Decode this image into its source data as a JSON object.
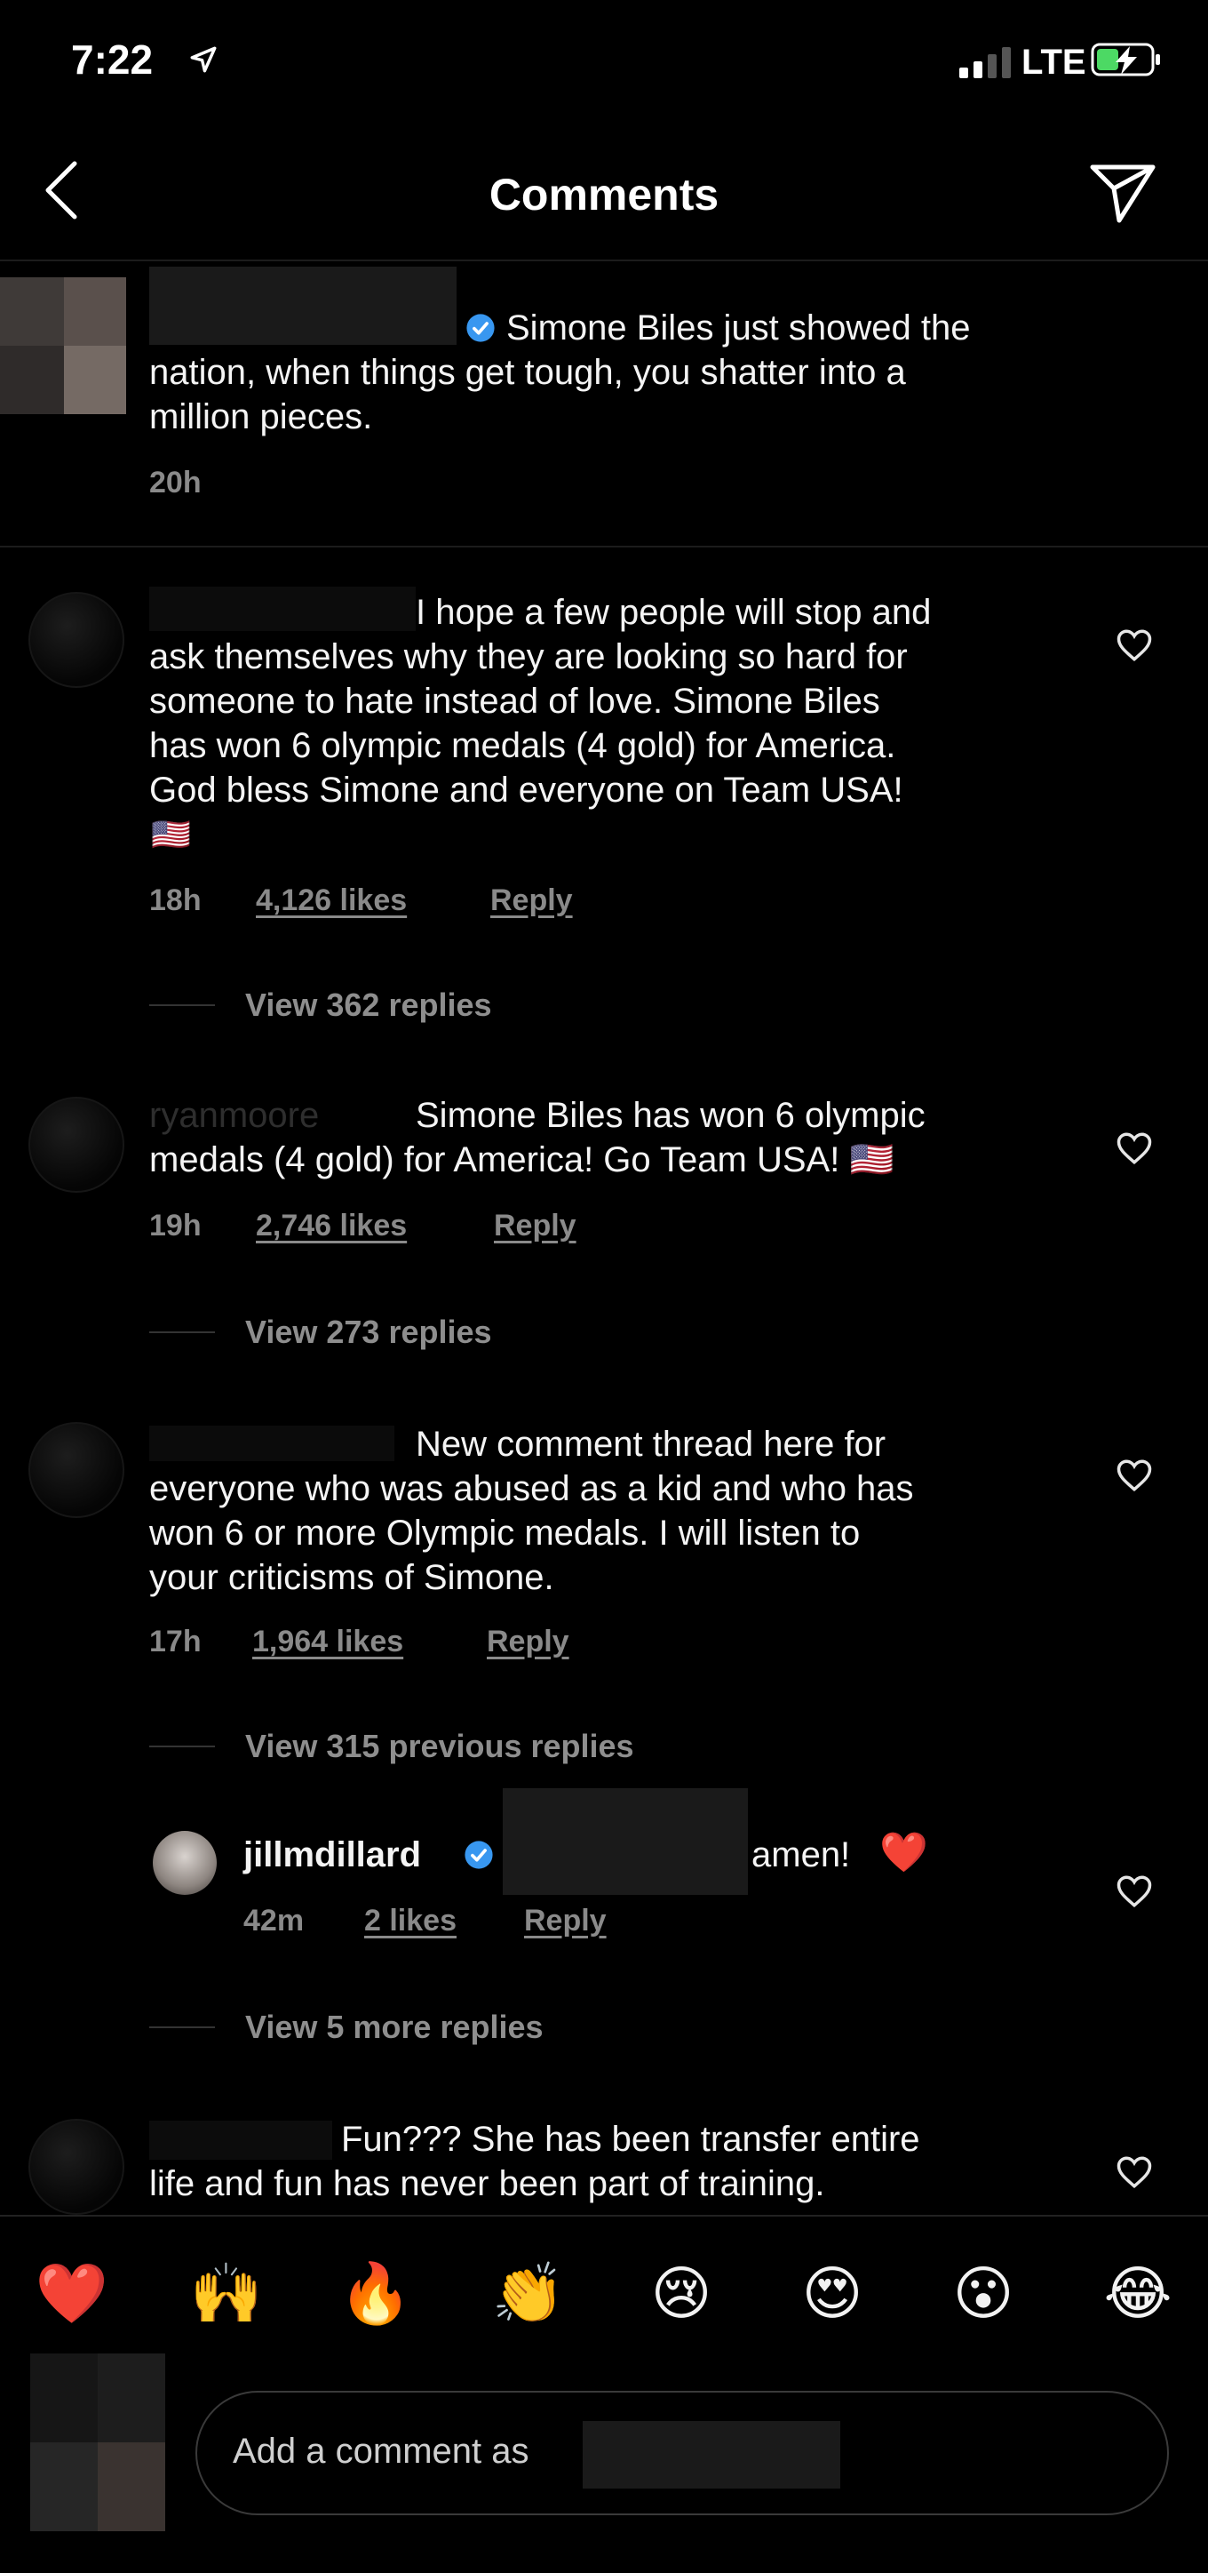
{
  "status_bar": {
    "time": "7:22",
    "network": "LTE"
  },
  "header": {
    "title": "Comments"
  },
  "caption": {
    "text_line1": "Simone Biles just showed the",
    "text_line2": "nation, when things get tough, you shatter into a",
    "text_line3": "million pieces.",
    "time": "20h"
  },
  "comments": [
    {
      "lines": [
        "I hope a few people will stop and",
        "ask themselves why they are looking so hard for",
        "someone to hate instead of love. Simone Biles",
        "has won 6 olympic medals (4 gold) for America.",
        "God bless Simone and everyone on Team USA!"
      ],
      "flag": "🇺🇸",
      "time": "18h",
      "likes": "4,126 likes",
      "reply": "Reply",
      "view_replies": "View 362 replies"
    },
    {
      "username_faded": "ryanmoore",
      "lines": [
        "Simone Biles has won 6 olympic",
        "medals (4 gold) for America! Go Team USA! 🇺🇸"
      ],
      "time": "19h",
      "likes": "2,746 likes",
      "reply": "Reply",
      "view_replies": "View 273 replies"
    },
    {
      "lines": [
        "New comment thread here for",
        "everyone who was abused as a kid and who has",
        "won 6 or more Olympic medals. I will listen to",
        "your criticisms of Simone."
      ],
      "time": "17h",
      "likes": "1,964 likes",
      "reply": "Reply",
      "view_replies": "View 315 previous replies"
    },
    {
      "lines": [
        "Fun??? She has been transfer entire",
        "life and fun has never been part of training."
      ]
    }
  ],
  "nested_reply": {
    "username": "jillmdillard",
    "text": "amen!",
    "emoji": "❤️",
    "time": "42m",
    "likes": "2 likes",
    "reply": "Reply",
    "view_more": "View 5 more replies"
  },
  "emoji_bar": [
    "❤️",
    "🙌",
    "🔥",
    "👏",
    "😢",
    "😍",
    "😮",
    "😂"
  ],
  "input": {
    "placeholder": "Add a comment as"
  },
  "colors": {
    "background": "#000000",
    "text": "#f4f4f4",
    "meta": "#8a8a8a",
    "verified": "#3897f0",
    "battery_charging": "#4cd964"
  }
}
